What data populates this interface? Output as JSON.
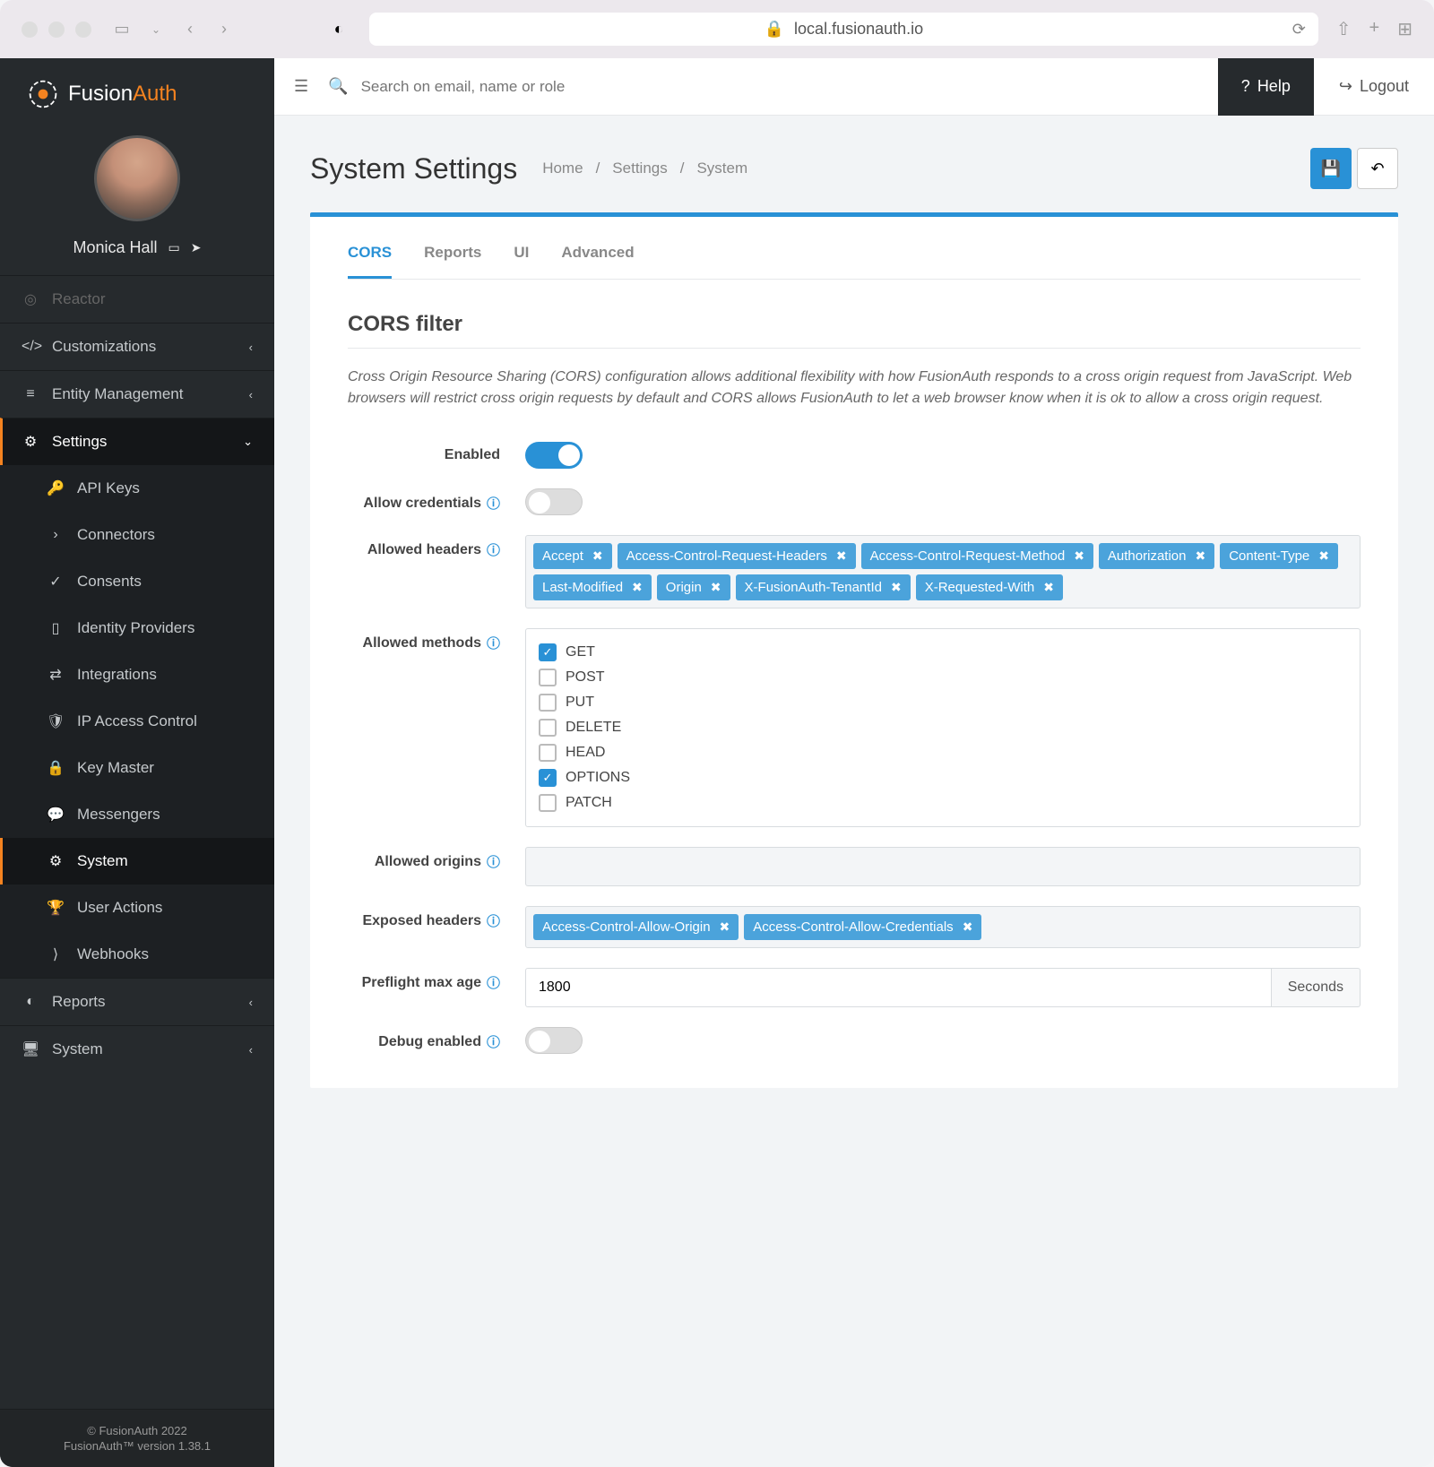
{
  "browser": {
    "url": "local.fusionauth.io"
  },
  "logo": {
    "brand": "Fusion",
    "accent": "Auth"
  },
  "user": {
    "name": "Monica Hall"
  },
  "sidebar": {
    "reactor": "Reactor",
    "customizations": "Customizations",
    "entity_mgmt": "Entity Management",
    "settings": "Settings",
    "api_keys": "API Keys",
    "connectors": "Connectors",
    "consents": "Consents",
    "identity_providers": "Identity Providers",
    "integrations": "Integrations",
    "ip_access": "IP Access Control",
    "key_master": "Key Master",
    "messengers": "Messengers",
    "system": "System",
    "user_actions": "User Actions",
    "webhooks": "Webhooks",
    "reports": "Reports",
    "system2": "System"
  },
  "footer": {
    "copyright": "© FusionAuth 2022",
    "version": "FusionAuth™ version 1.38.1"
  },
  "topbar": {
    "search_placeholder": "Search on email, name or role",
    "help": "Help",
    "logout": "Logout"
  },
  "page": {
    "title": "System Settings",
    "crumbs": {
      "home": "Home",
      "settings": "Settings",
      "system": "System"
    }
  },
  "tabs": {
    "cors": "CORS",
    "reports": "Reports",
    "ui": "UI",
    "advanced": "Advanced"
  },
  "section": {
    "title": "CORS filter",
    "desc": "Cross Origin Resource Sharing (CORS) configuration allows additional flexibility with how FusionAuth responds to a cross origin request from JavaScript. Web browsers will restrict cross origin requests by default and CORS allows FusionAuth to let a web browser know when it is ok to allow a cross origin request."
  },
  "labels": {
    "enabled": "Enabled",
    "allow_credentials": "Allow credentials",
    "allowed_headers": "Allowed headers",
    "allowed_methods": "Allowed methods",
    "allowed_origins": "Allowed origins",
    "exposed_headers": "Exposed headers",
    "preflight": "Preflight max age",
    "debug": "Debug enabled"
  },
  "allowed_headers": [
    "Accept",
    "Access-Control-Request-Headers",
    "Access-Control-Request-Method",
    "Authorization",
    "Content-Type",
    "Last-Modified",
    "Origin",
    "X-FusionAuth-TenantId",
    "X-Requested-With"
  ],
  "methods": [
    {
      "label": "GET",
      "checked": true
    },
    {
      "label": "POST",
      "checked": false
    },
    {
      "label": "PUT",
      "checked": false
    },
    {
      "label": "DELETE",
      "checked": false
    },
    {
      "label": "HEAD",
      "checked": false
    },
    {
      "label": "OPTIONS",
      "checked": true
    },
    {
      "label": "PATCH",
      "checked": false
    }
  ],
  "exposed_headers": [
    "Access-Control-Allow-Origin",
    "Access-Control-Allow-Credentials"
  ],
  "preflight": {
    "value": "1800",
    "unit": "Seconds"
  }
}
